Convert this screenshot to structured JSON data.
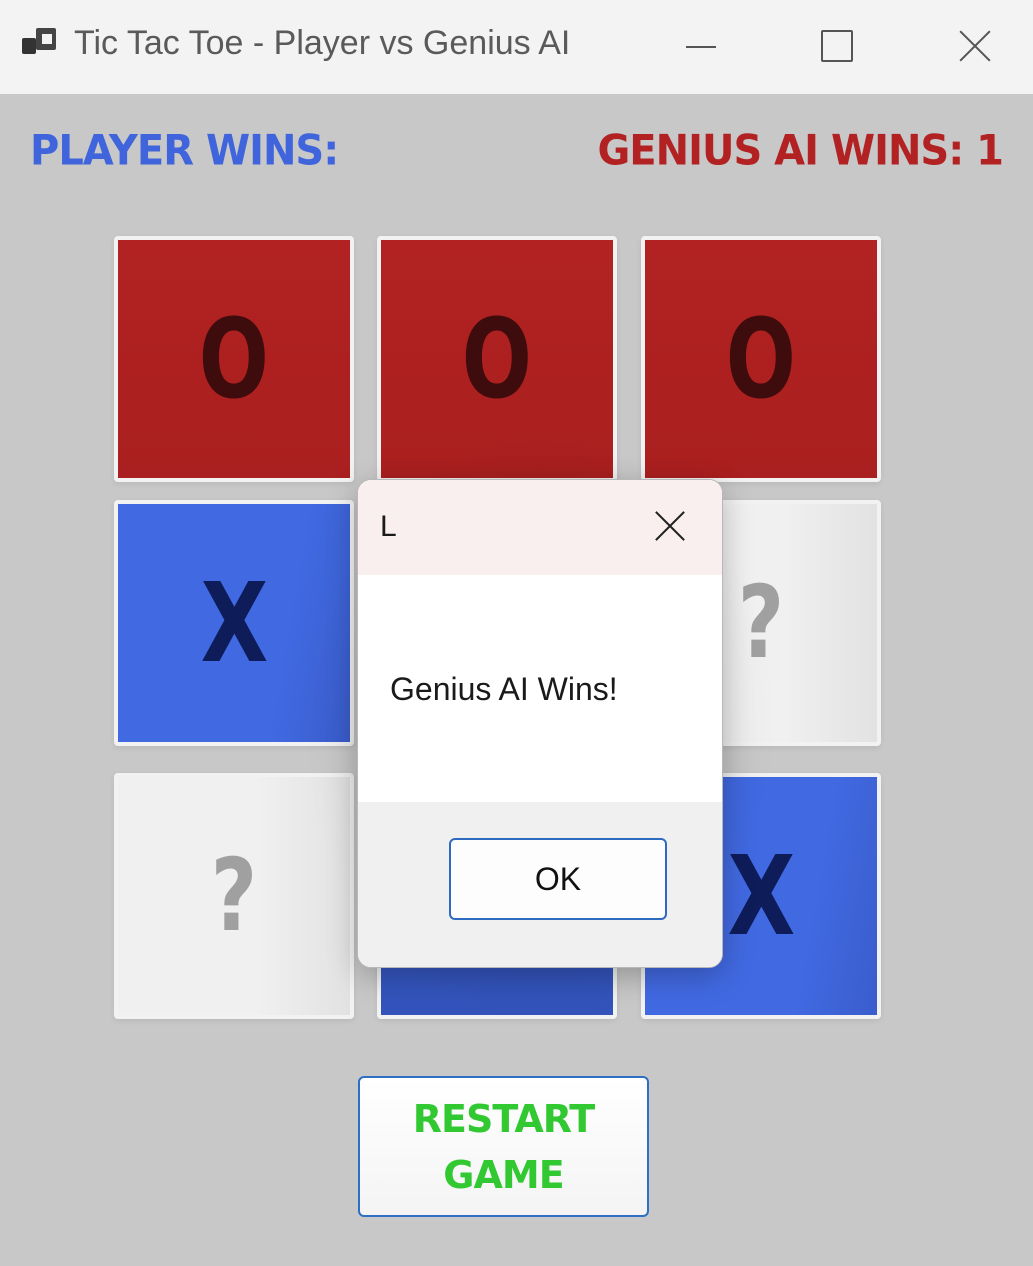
{
  "window": {
    "title": "Tic Tac Toe - Player vs Genius AI"
  },
  "scores": {
    "player_label": "PLAYER WINS:",
    "ai_label": "GENIUS AI WINS: 1"
  },
  "board": {
    "cells": [
      {
        "mark": "O",
        "state": "ai"
      },
      {
        "mark": "O",
        "state": "ai"
      },
      {
        "mark": "O",
        "state": "ai"
      },
      {
        "mark": "X",
        "state": "player"
      },
      {
        "mark": "",
        "state": "hidden"
      },
      {
        "mark": "?",
        "state": "empty"
      },
      {
        "mark": "?",
        "state": "empty"
      },
      {
        "mark": "",
        "state": "player"
      },
      {
        "mark": "X",
        "state": "player"
      }
    ]
  },
  "restart": {
    "label": "RESTART\nGAME"
  },
  "dialog": {
    "title": "L",
    "message": "Genius AI Wins!",
    "ok_label": "OK"
  },
  "colors": {
    "ai": "#b22222",
    "player": "#4169e1",
    "empty": "#f0f0f0",
    "restart_text": "#32c832"
  }
}
